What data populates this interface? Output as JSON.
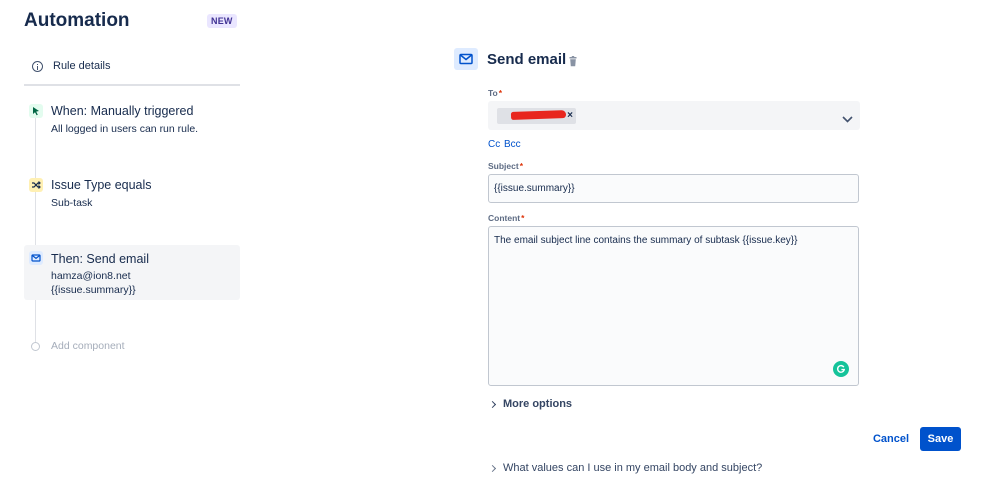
{
  "app": {
    "title": "Automation",
    "badge": "NEW"
  },
  "sidebar": {
    "rule_details_label": "Rule details",
    "steps": [
      {
        "title": "When: Manually triggered",
        "lines": [
          "All logged in users can run rule."
        ],
        "icon": "cursor-click-icon",
        "color": "#e3fcef"
      },
      {
        "title": "Issue Type equals",
        "lines": [
          "Sub-task"
        ],
        "icon": "shuffle-icon",
        "color": "#fff0b3"
      },
      {
        "title": "Then: Send email",
        "lines": [
          "hamza@ion8.net",
          "{{issue.summary}}"
        ],
        "icon": "email-icon",
        "color": "#deebff"
      }
    ],
    "add_component_label": "Add component"
  },
  "panel": {
    "title": "Send email",
    "to_label": "To",
    "to_required": "*",
    "chip_remove": "×",
    "cc_label": "Cc",
    "bcc_label": "Bcc",
    "subject_label": "Subject",
    "subject_required": "*",
    "subject_value": "{{issue.summary}}",
    "content_label": "Content",
    "content_required": "*",
    "content_value": "The email subject line contains the summary of subtask {{issue.key}}",
    "more_options_label": "More options",
    "cancel_label": "Cancel",
    "save_label": "Save",
    "help_label": "What values can I use in my email body and subject?"
  },
  "colors": {
    "primary": "#0052cc",
    "required": "#de350b",
    "redaction": "#e8261e",
    "grammarly": "#15c39a"
  }
}
